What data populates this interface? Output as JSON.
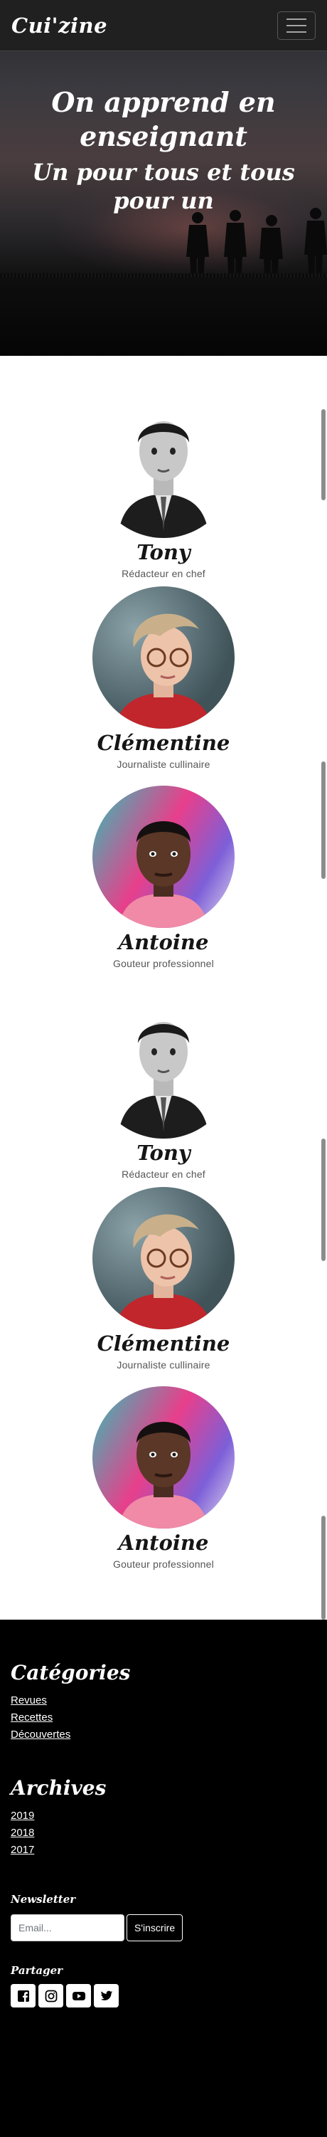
{
  "navbar": {
    "brand": "Cui'zine",
    "toggle_icon": "hamburger-icon"
  },
  "hero": {
    "title": "On apprend en enseignant",
    "subtitle": "Un pour tous et tous pour un"
  },
  "team": {
    "members": [
      {
        "name": "Tony",
        "role": "Rédacteur en chef",
        "avatar": "man-suit-avatar"
      },
      {
        "name": "Clémentine",
        "role": "Journaliste cullinaire",
        "avatar": "woman-glasses-avatar"
      },
      {
        "name": "Antoine",
        "role": "Gouteur professionnel",
        "avatar": "man-pink-shirt-avatar"
      },
      {
        "name": "Tony",
        "role": "Rédacteur en chef",
        "avatar": "man-suit-avatar"
      },
      {
        "name": "Clémentine",
        "role": "Journaliste cullinaire",
        "avatar": "woman-glasses-avatar"
      },
      {
        "name": "Antoine",
        "role": "Gouteur professionnel",
        "avatar": "man-pink-shirt-avatar"
      }
    ]
  },
  "footer": {
    "categories": {
      "heading": "Catégories",
      "links": [
        "Revues",
        "Recettes",
        "Découvertes"
      ]
    },
    "archives": {
      "heading": "Archives",
      "links": [
        "2019",
        "2018",
        "2017"
      ]
    },
    "newsletter": {
      "heading": "Newsletter",
      "placeholder": "Email...",
      "button": "S'inscrire"
    },
    "share": {
      "heading": "Partager",
      "icons": [
        "facebook-icon",
        "instagram-icon",
        "youtube-icon",
        "twitter-icon"
      ]
    }
  },
  "colors": {
    "navbar_bg": "#202020",
    "footer_bg": "#000000",
    "text_dark": "#151515"
  }
}
